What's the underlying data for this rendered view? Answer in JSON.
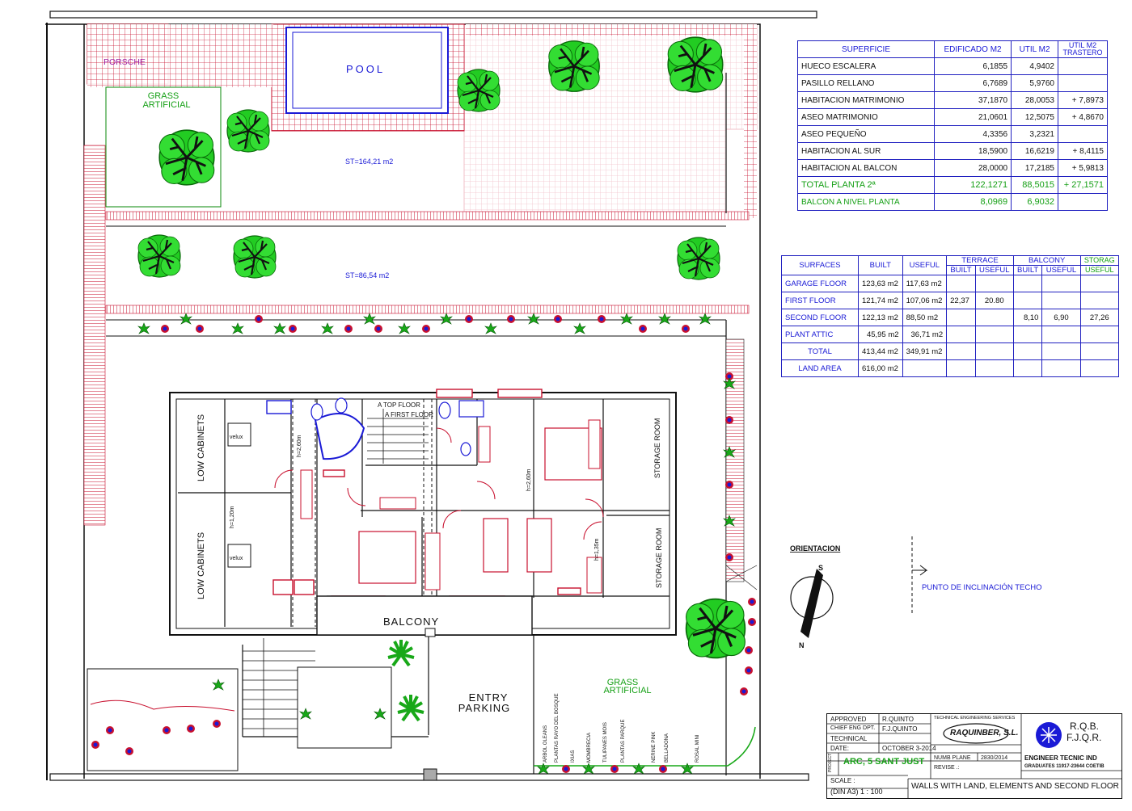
{
  "colors": {
    "wall": "#111111",
    "fence": "#c8102e",
    "text_blue": "#1a1ad6",
    "text_green": "#16a016",
    "tree": "#22cc22"
  },
  "plan": {
    "porsche": "PORSCHE",
    "pool": "POOL",
    "grass_top": [
      "GRASS",
      "ARTIFICIAL"
    ],
    "grass_bottom": [
      "GRASS",
      "ARTIFICIAL"
    ],
    "st1": "ST=164,21 m2",
    "st2": "ST=86,54 m2",
    "low_cabinets_1": "LOW CABINETS",
    "low_cabinets_2": "LOW CABINETS",
    "velux_1": "velux",
    "velux_2": "velux",
    "h1": "h=2,60m",
    "h2": "h=1,20m",
    "h3": "h=2,60m",
    "h4": "h=1,35m",
    "top_floor": "A TOP FLOOR",
    "first_floor": "A FIRST FLOOR",
    "storage_1": "STORAGE ROOM",
    "storage_2": "STORAGE ROOM",
    "balcony": "BALCONY",
    "entry": [
      "ENTRY",
      "PARKING"
    ],
    "orientation": "ORIENTACION",
    "punto": "PUNTO DE INCLINACIÓN TECHO",
    "north_s": "S",
    "north_n": "N",
    "plants": [
      "ARBOL OLEANS",
      "PLANTAS RAYO DEL BOSQUE",
      "IXIAS",
      "MOMBRECIA",
      "TULIPANES MOIS",
      "PLANTAS PARQUE",
      "NERINE PINK",
      "BELLADONA",
      "ROSAL MINI"
    ]
  },
  "table1": {
    "headers": [
      "SUPERFICIE",
      "EDIFICADO M2",
      "UTIL M2",
      "UTIL M2 TRASTERO"
    ],
    "rows": [
      [
        "HUECO ESCALERA",
        "6,1855",
        "4,9402",
        ""
      ],
      [
        "PASILLO RELLANO",
        "6,7689",
        "5,9760",
        ""
      ],
      [
        "HABITACION MATRIMONIO",
        "37,1870",
        "28,0053",
        "+ 7,8973"
      ],
      [
        "ASEO MATRIMONIO",
        "21,0601",
        "12,5075",
        "+ 4,8670"
      ],
      [
        "ASEO PEQUEÑO",
        "4,3356",
        "3,2321",
        ""
      ],
      [
        "HABITACION AL SUR",
        "18,5900",
        "16,6219",
        "+ 8,4115"
      ],
      [
        "HABITACION AL BALCON",
        "28,0000",
        "17,2185",
        "+ 5,9813"
      ]
    ],
    "total": [
      "TOTAL PLANTA 2ª",
      "122,1271",
      "88,5015",
      "+ 27,1571"
    ],
    "balcon": [
      "BALCON A NIVEL PLANTA",
      "8,0969",
      "6,9032",
      ""
    ]
  },
  "table2": {
    "headers": [
      "SURFACES",
      "BUILT",
      "USEFUL",
      "TERRACE",
      "BUILT",
      "USEFUL",
      "BALCONY",
      "BUILT",
      "USEFUL",
      "STORAG",
      "USEFUL"
    ],
    "rows": [
      [
        "GARAGE FLOOR",
        "123,63 m2",
        "117,63 m2",
        "",
        "",
        "",
        "",
        ""
      ],
      [
        "FIRST FLOOR",
        "121,74 m2",
        "107,06 m2",
        "22,37",
        "20.80",
        "",
        "",
        ""
      ],
      [
        "SECOND FLOOR",
        "122,13 m2",
        "88,50 m2",
        "",
        "",
        "8,10",
        "6,90",
        "27,26"
      ],
      [
        "PLANT ATTIC",
        "45,95 m2",
        "36,71 m2",
        "",
        "",
        "",
        "",
        ""
      ],
      [
        "TOTAL",
        "413,44 m2",
        "349,91 m2",
        "",
        "",
        "",
        "",
        ""
      ],
      [
        "LAND  AREA",
        "616,00 m2",
        "",
        "",
        "",
        "",
        "",
        ""
      ]
    ]
  },
  "title_block": {
    "approved": "APPROVED",
    "approved_by": "R.QUINTO",
    "chief": "CHIEF ENG DPT.",
    "chief_by": "F.J.QUINTO",
    "technical": "TECHNICAL",
    "date_label": "DATE:",
    "date": "OCTOBER 3-2014",
    "project_label": "PROJECT",
    "project": "ARC, 5  SANT JUST",
    "scale_label": "SCALE :",
    "scale": "(DIN A3)   1 : 100",
    "services": "TECHNICAL ENGINEERING SERVICES",
    "company": "RAQUINBER, S.L.",
    "numb_label": "NUMB PLANE",
    "numb": "2830/2014",
    "revise": "REVISE .:",
    "initials1": "R.Q.B.",
    "initials2": "F.J.Q.R.",
    "engineer": "ENGINEER TECNIC IND",
    "graduates": "GRADUATES 11917-23644 COETIB",
    "drawing_title": "WALLS WITH LAND, ELEMENTS AND SECOND FLOOR"
  }
}
